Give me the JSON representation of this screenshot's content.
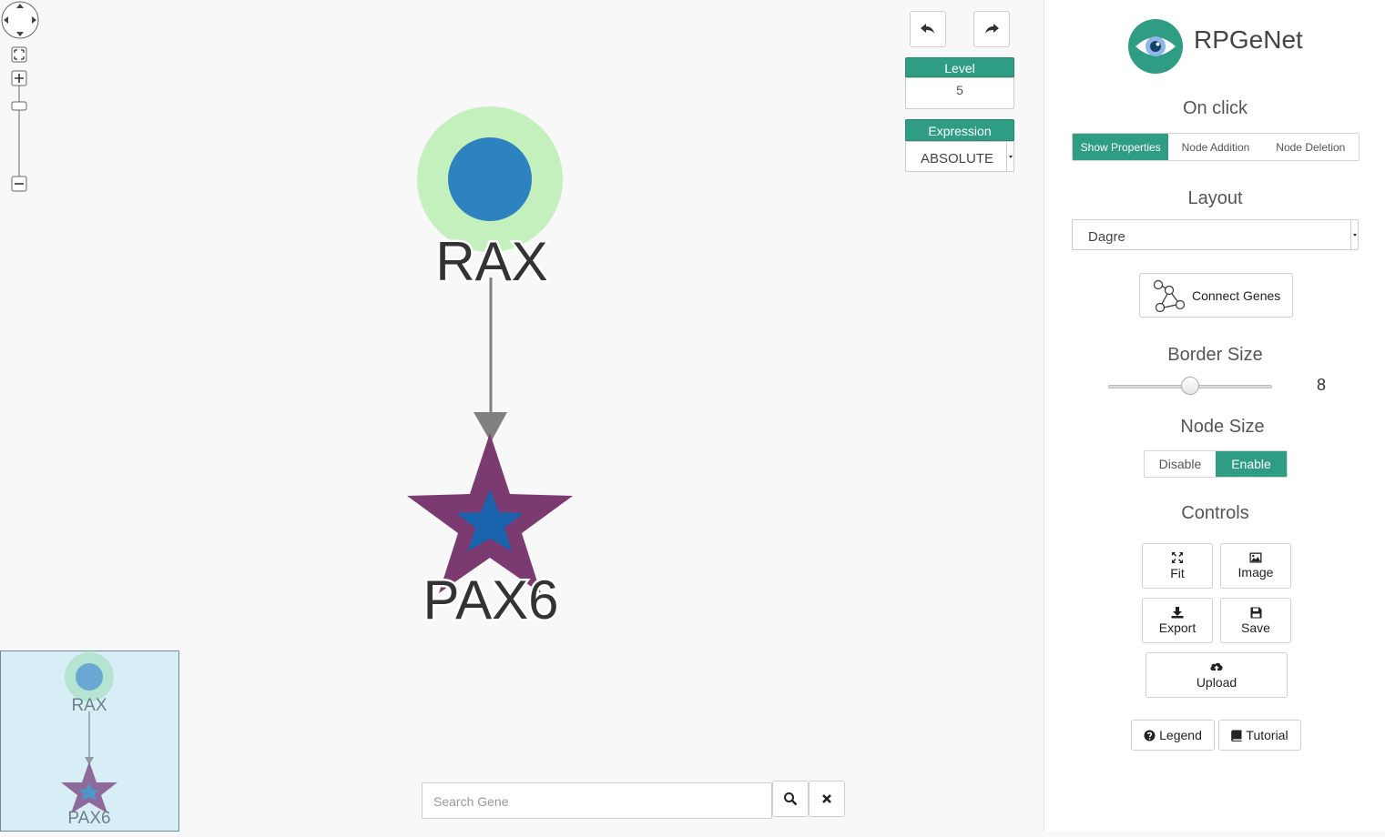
{
  "app": {
    "name": "RPGeNet"
  },
  "toolbar": {
    "undo_icon": "undo-icon",
    "redo_icon": "redo-icon",
    "level_label": "Level",
    "level_value": "5",
    "expression_label": "Expression",
    "expression_value": "ABSOLUTE"
  },
  "graph": {
    "nodes": [
      {
        "label": "RAX",
        "shape": "circle",
        "color": "#2f82c0",
        "border_color": "#c3f0bd"
      },
      {
        "label": "PAX6",
        "shape": "star",
        "color": "#1a64ad",
        "border_color": "#7b3a70"
      }
    ],
    "edge_color": "#808080"
  },
  "minimap": {
    "nodes": [
      "RAX",
      "PAX6"
    ]
  },
  "search": {
    "placeholder": "Search Gene",
    "search_icon": "search-icon",
    "clear_icon": "close-icon"
  },
  "sidebar": {
    "on_click_title": "On click",
    "on_click_options": [
      "Show Properties",
      "Node Addition",
      "Node Deletion"
    ],
    "on_click_selected": "Show Properties",
    "layout_title": "Layout",
    "layout_value": "Dagre",
    "connect_genes_label": "Connect Genes",
    "border_size_title": "Border Size",
    "border_size_value": "8",
    "node_size_title": "Node Size",
    "node_size_options": [
      "Disable",
      "Enable"
    ],
    "node_size_selected": "Enable",
    "controls_title": "Controls",
    "controls": {
      "fit": "Fit",
      "image": "Image",
      "export": "Export",
      "save": "Save",
      "upload": "Upload"
    },
    "legend_label": "Legend",
    "tutorial_label": "Tutorial"
  },
  "colors": {
    "accent": "#2e9d84",
    "logo": "#2e9d84"
  }
}
